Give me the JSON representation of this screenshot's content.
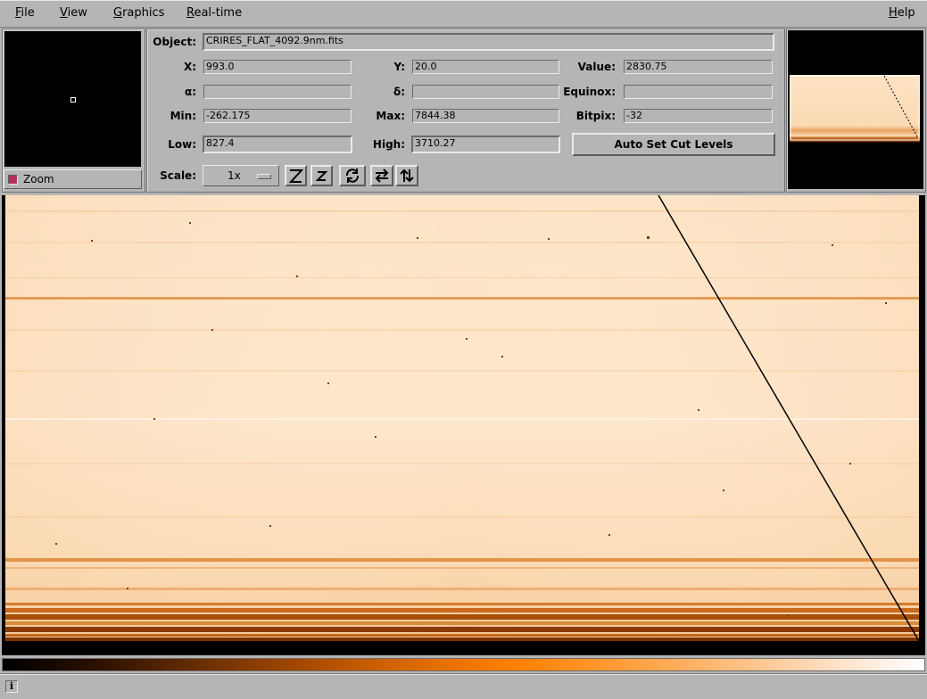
{
  "menu": {
    "file": "File",
    "view": "View",
    "graphics": "Graphics",
    "realtime": "Real-time",
    "help": "Help"
  },
  "zoom": {
    "label": "Zoom",
    "checked": true
  },
  "info": {
    "object_label": "Object:",
    "object_value": "CRIRES_FLAT_4092.9nm.fits",
    "x_label": "X:",
    "x_value": "993.0",
    "y_label": "Y:",
    "y_value": "20.0",
    "value_label": "Value:",
    "value_value": "2830.75",
    "alpha_label": "α:",
    "alpha_value": "",
    "delta_label": "δ:",
    "delta_value": "",
    "equinox_label": "Equinox:",
    "equinox_value": "",
    "min_label": "Min:",
    "min_value": "-262.175",
    "max_label": "Max:",
    "max_value": "7844.38",
    "bitpix_label": "Bitpix:",
    "bitpix_value": "-32",
    "low_label": "Low:",
    "low_value": "827.4",
    "high_label": "High:",
    "high_value": "3710.27",
    "auto_cut_label": "Auto Set Cut Levels",
    "scale_label": "Scale:",
    "scale_value": "1x"
  },
  "toolbar_icons": [
    "zoom-in-icon",
    "zoom-out-icon",
    "rotate-icon",
    "flip-x-icon",
    "flip-y-icon"
  ],
  "colors": {
    "image_base": "#fde3c4",
    "image_band": "#e58a3a",
    "image_dark_band": "#8a3a00",
    "zoom_check": "#b03060"
  },
  "status": {
    "icon": "i",
    "text": ""
  }
}
